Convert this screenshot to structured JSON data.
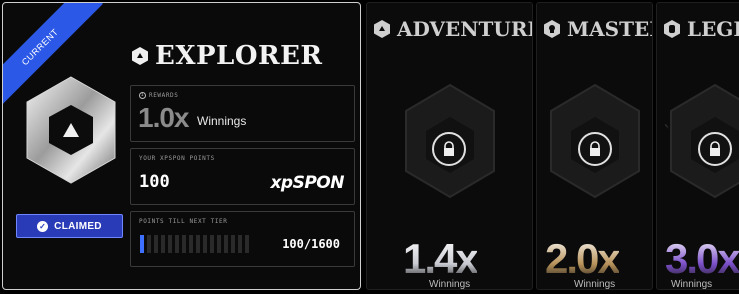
{
  "current_tier": {
    "ribbon": "CURRENT",
    "name": "EXPLORER",
    "claimed_label": "CLAIMED",
    "rewards": {
      "label": "REWARDS",
      "value": "1.0x",
      "unit": "Winnings"
    },
    "points": {
      "label": "YOUR XPSPON POINTS",
      "value": "100",
      "logo": "xpSPON"
    },
    "next_tier": {
      "label": "POINTS TILL NEXT TIER",
      "value": "100/1600",
      "progress": 0.0625
    }
  },
  "locked_tiers": [
    {
      "name": "ADVENTURER",
      "multiplier": "1.4x",
      "unit": "Winnings",
      "color": "#c9cbd2"
    },
    {
      "name": "MASTER",
      "multiplier": "2.0x",
      "unit": "Winnings",
      "color": "#b8935a"
    },
    {
      "name": "LEGE",
      "multiplier": "3.0x",
      "unit": "Winnings",
      "color": "#7b4fc9"
    }
  ],
  "colors": {
    "accent": "#2b58e6",
    "claimed_bg": "#2a3bb8",
    "progress": "#3e70ff"
  }
}
